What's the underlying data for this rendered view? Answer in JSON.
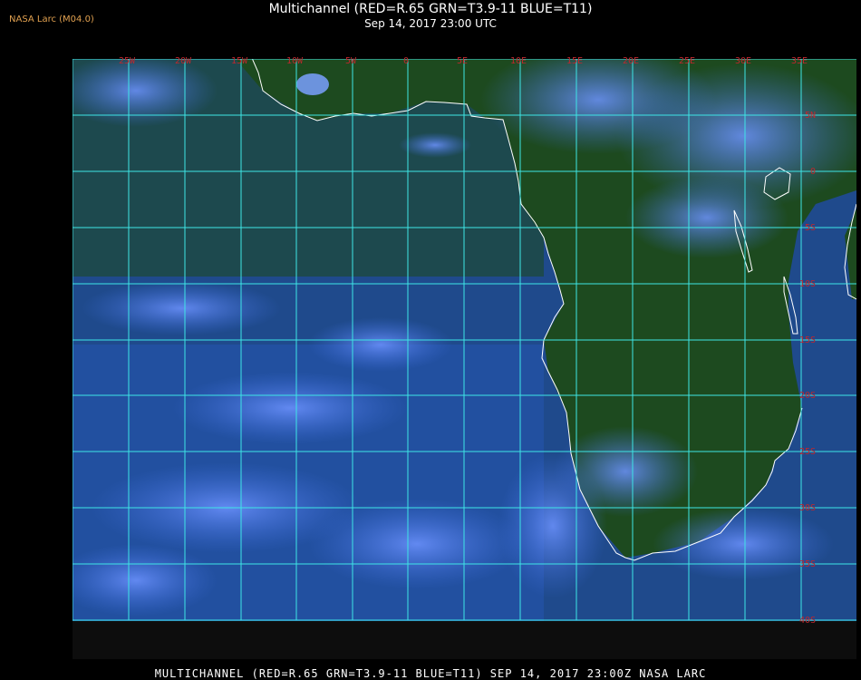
{
  "header": {
    "source_label": "NASA Larc (M04.0)",
    "title": "Multichannel (RED=R.65 GRN=T3.9-11 BLUE=T11)",
    "subtitle": "Sep 14, 2017 23:00 UTC"
  },
  "footer": {
    "caption": "MULTICHANNEL (RED=R.65 GRN=T3.9-11 BLUE=T11) SEP 14, 2017 23:00Z   NASA LARC"
  },
  "map": {
    "longitude_labels": [
      "25W",
      "20W",
      "15W",
      "10W",
      "5W",
      "0",
      "5E",
      "10E",
      "15E",
      "20E",
      "25E",
      "30E",
      "35E"
    ],
    "latitude_labels": [
      "5N",
      "0",
      "5S",
      "10S",
      "15S",
      "20S",
      "25S",
      "30S",
      "35S",
      "40S"
    ],
    "colors": {
      "ocean_base": "#1f4a8c",
      "land_base": "#1d4a1f",
      "cloud": "#4a7cf0",
      "grid": "#3ee6e6",
      "coastline": "#ffffff",
      "grid_label": "#c0272d",
      "source_label": "#e0a050"
    }
  }
}
